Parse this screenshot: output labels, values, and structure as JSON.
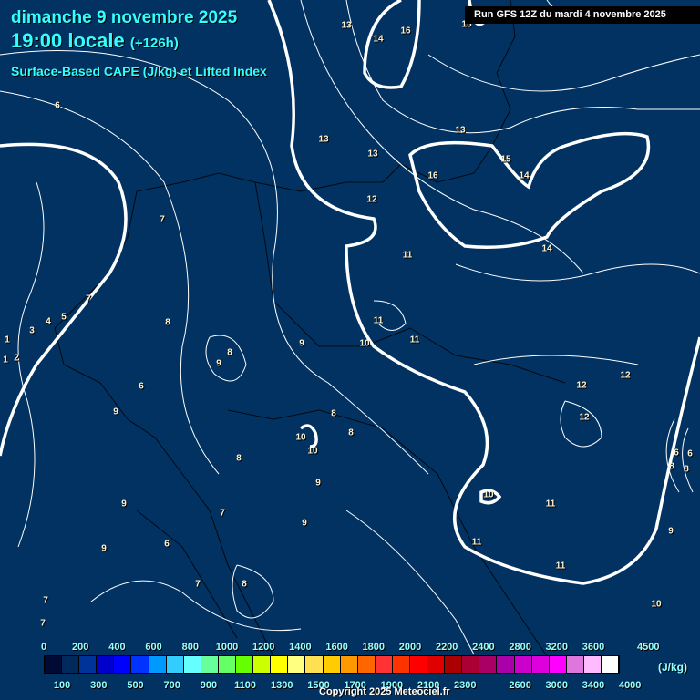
{
  "header": {
    "date": "dimanche 9 novembre 2025",
    "time": "19:00 locale",
    "lead": "(+126h)",
    "parameter": "Surface-Based CAPE (J/kg) et Lifted Index",
    "run": "Run GFS 12Z du mardi 4 novembre 2025"
  },
  "legend": {
    "unit": "(J/kg)",
    "top_labels": [
      "0",
      "200",
      "400",
      "600",
      "800",
      "1000",
      "1200",
      "1400",
      "1600",
      "1800",
      "2000",
      "2200",
      "2400",
      "2800",
      "3200",
      "3600",
      "4500"
    ],
    "bottom_labels": [
      "100",
      "300",
      "500",
      "700",
      "900",
      "1100",
      "1300",
      "1500",
      "1700",
      "1900",
      "2100",
      "2300",
      "2600",
      "3000",
      "3400",
      "4000"
    ],
    "colors": [
      "#000a33",
      "#002a5c",
      "#003399",
      "#0000cc",
      "#0000ff",
      "#0033ff",
      "#0099ff",
      "#33ccff",
      "#66ffff",
      "#66ff99",
      "#66ff66",
      "#66ff00",
      "#ccff00",
      "#ffff00",
      "#ffff80",
      "#ffe050",
      "#ffcc00",
      "#ff9900",
      "#ff6600",
      "#ff3333",
      "#ff3300",
      "#ff0000",
      "#e00000",
      "#aa0000",
      "#aa0033",
      "#aa0066",
      "#aa00aa",
      "#cc00cc",
      "#dd00dd",
      "#ff00ff",
      "#dd77dd",
      "#ffbbff",
      "#ffffff"
    ]
  },
  "lifted_index_labels": [
    "13",
    "14",
    "16",
    "15",
    "13",
    "13",
    "13",
    "15",
    "14",
    "16",
    "12",
    "7",
    "11",
    "14",
    "6",
    "7",
    "4",
    "5",
    "3",
    "8",
    "11",
    "1",
    "1",
    "2",
    "8",
    "9",
    "10",
    "11",
    "9",
    "12",
    "12",
    "6",
    "9",
    "8",
    "8",
    "12",
    "10",
    "10",
    "8",
    "9",
    "10",
    "11",
    "7",
    "6",
    "8",
    "8",
    "9",
    "9",
    "11",
    "9",
    "6",
    "7",
    "8",
    "7",
    "11",
    "7",
    "10",
    "9",
    "6"
  ],
  "copyright": "Copyright 2025 Meteociel.fr"
}
